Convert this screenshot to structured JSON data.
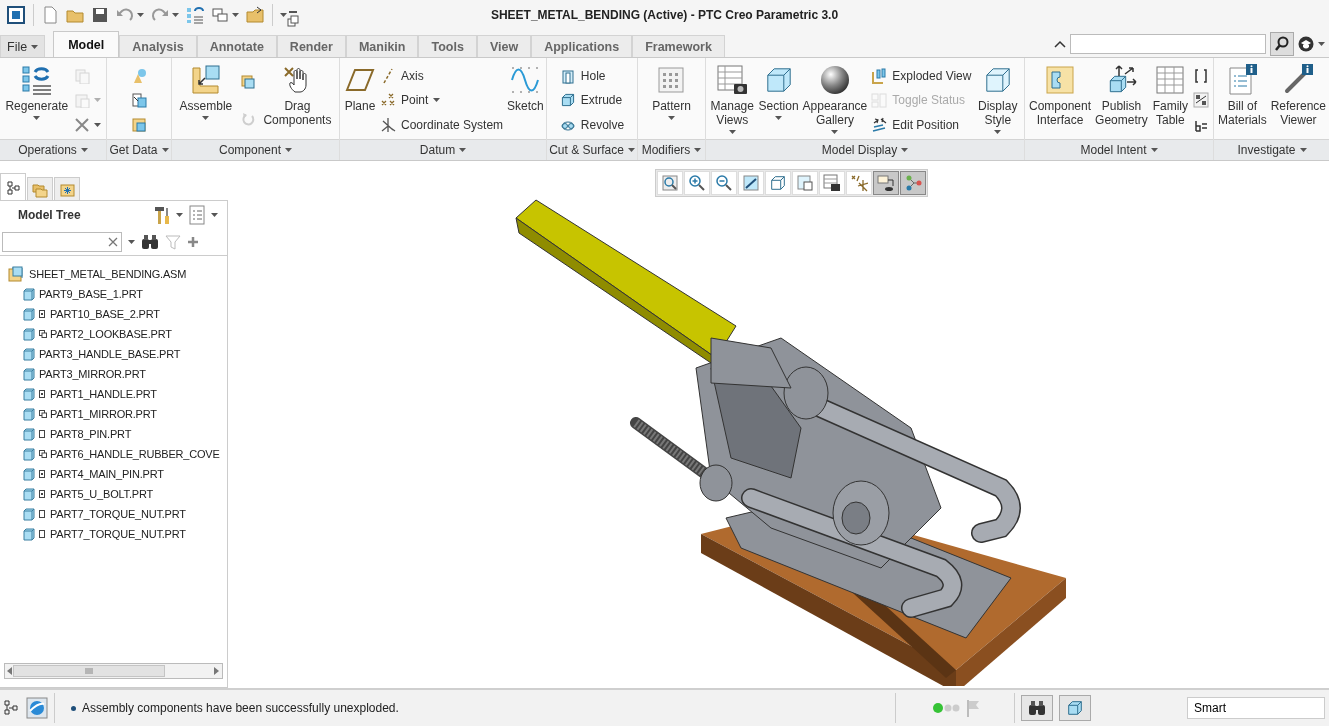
{
  "window": {
    "title": "SHEET_METAL_BENDING (Active) - PTC Creo Parametric 3.0"
  },
  "file_menu": {
    "label": "File"
  },
  "tabs": [
    {
      "label": "Model",
      "selected": true
    },
    {
      "label": "Analysis",
      "selected": false
    },
    {
      "label": "Annotate",
      "selected": false
    },
    {
      "label": "Render",
      "selected": false
    },
    {
      "label": "Manikin",
      "selected": false
    },
    {
      "label": "Tools",
      "selected": false
    },
    {
      "label": "View",
      "selected": false
    },
    {
      "label": "Applications",
      "selected": false
    },
    {
      "label": "Framework",
      "selected": false
    }
  ],
  "ribbon": {
    "groups": [
      {
        "label": "Operations",
        "items": [
          {
            "kind": "large",
            "label": "Regenerate",
            "dropdown": true,
            "disabled": false
          },
          {
            "kind": "icon",
            "dropdown": false,
            "disabled": true
          },
          {
            "kind": "icon",
            "dropdown": true,
            "disabled": true
          },
          {
            "kind": "icon",
            "dropdown": true,
            "disabled": false
          }
        ]
      },
      {
        "label": "Get Data",
        "items": [
          {
            "kind": "icon",
            "dropdown": false,
            "disabled": false
          },
          {
            "kind": "icon",
            "dropdown": false,
            "disabled": false
          },
          {
            "kind": "icon",
            "dropdown": false,
            "disabled": false
          }
        ]
      },
      {
        "label": "Component",
        "items": [
          {
            "kind": "large",
            "label": "Assemble",
            "dropdown": true,
            "disabled": false
          },
          {
            "kind": "icon",
            "dropdown": false,
            "disabled": false
          },
          {
            "kind": "icon",
            "dropdown": false,
            "disabled": true
          },
          {
            "kind": "large",
            "label": "Drag Components",
            "dropdown": false,
            "disabled": false
          }
        ]
      },
      {
        "label": "Datum",
        "items": [
          {
            "kind": "large",
            "label": "Plane",
            "dropdown": false,
            "disabled": false
          },
          {
            "kind": "small",
            "label": "Axis",
            "dropdown": false,
            "disabled": false
          },
          {
            "kind": "small",
            "label": "Point",
            "dropdown": true,
            "disabled": false
          },
          {
            "kind": "small",
            "label": "Coordinate System",
            "dropdown": false,
            "disabled": false
          },
          {
            "kind": "large",
            "label": "Sketch",
            "dropdown": false,
            "disabled": false
          }
        ]
      },
      {
        "label": "Cut & Surface",
        "items": [
          {
            "kind": "small",
            "label": "Hole",
            "dropdown": false,
            "disabled": false
          },
          {
            "kind": "small",
            "label": "Extrude",
            "dropdown": false,
            "disabled": false
          },
          {
            "kind": "small",
            "label": "Revolve",
            "dropdown": false,
            "disabled": false
          }
        ]
      },
      {
        "label": "Modifiers",
        "items": [
          {
            "kind": "large",
            "label": "Pattern",
            "dropdown": true,
            "disabled": false
          }
        ]
      },
      {
        "label": "Model Display",
        "items": [
          {
            "kind": "large",
            "label": "Manage Views",
            "dropdown": true,
            "disabled": false
          },
          {
            "kind": "large",
            "label": "Section",
            "dropdown": true,
            "disabled": false
          },
          {
            "kind": "large",
            "label": "Appearance Gallery",
            "dropdown": true,
            "disabled": false
          },
          {
            "kind": "small",
            "label": "Exploded View",
            "dropdown": false,
            "disabled": false
          },
          {
            "kind": "small",
            "label": "Toggle Status",
            "dropdown": false,
            "disabled": true
          },
          {
            "kind": "small",
            "label": "Edit Position",
            "dropdown": false,
            "disabled": false
          },
          {
            "kind": "large",
            "label": "Display Style",
            "dropdown": true,
            "disabled": false
          }
        ]
      },
      {
        "label": "Model Intent",
        "items": [
          {
            "kind": "large",
            "label": "Component Interface",
            "dropdown": false,
            "disabled": false
          },
          {
            "kind": "large",
            "label": "Publish Geometry",
            "dropdown": false,
            "disabled": false
          },
          {
            "kind": "large",
            "label": "Family Table",
            "dropdown": false,
            "disabled": false
          },
          {
            "kind": "icon",
            "dropdown": false,
            "disabled": false
          },
          {
            "kind": "icon",
            "dropdown": false,
            "disabled": false
          },
          {
            "kind": "icon",
            "dropdown": false,
            "disabled": false
          }
        ]
      },
      {
        "label": "Investigate",
        "items": [
          {
            "kind": "large",
            "label": "Bill of Materials",
            "dropdown": false,
            "disabled": false
          },
          {
            "kind": "large",
            "label": "Reference Viewer",
            "dropdown": false,
            "disabled": false
          }
        ]
      }
    ]
  },
  "panel_tabs": [
    {
      "selected": true
    },
    {
      "selected": false
    },
    {
      "selected": false
    }
  ],
  "model_tree": {
    "title": "Model Tree",
    "root": {
      "label": "SHEET_METAL_BENDING.ASM",
      "children": [
        {
          "label": "PART9_BASE_1.PRT",
          "kind": "plain"
        },
        {
          "label": "PART10_BASE_2.PRT",
          "kind": "dot"
        },
        {
          "label": "PART2_LOOKBASE.PRT",
          "kind": "link"
        },
        {
          "label": "PART3_HANDLE_BASE.PRT",
          "kind": "plain"
        },
        {
          "label": "PART3_MIRROR.PRT",
          "kind": "plain"
        },
        {
          "label": "PART1_HANDLE.PRT",
          "kind": "dot"
        },
        {
          "label": "PART1_MIRROR.PRT",
          "kind": "link"
        },
        {
          "label": "PART8_PIN.PRT",
          "kind": "box"
        },
        {
          "label": "PART6_HANDLE_RUBBER_COVE",
          "kind": "link"
        },
        {
          "label": "PART4_MAIN_PIN.PRT",
          "kind": "dot"
        },
        {
          "label": "PART5_U_BOLT.PRT",
          "kind": "dot"
        },
        {
          "label": "PART7_TORQUE_NUT.PRT",
          "kind": "box"
        },
        {
          "label": "PART7_TORQUE_NUT.PRT",
          "kind": "box"
        }
      ]
    }
  },
  "view_toolbar": [
    {
      "selected": false
    },
    {
      "selected": false
    },
    {
      "selected": false
    },
    {
      "selected": false
    },
    {
      "selected": false
    },
    {
      "selected": false
    },
    {
      "selected": false
    },
    {
      "selected": false
    },
    {
      "selected": true
    },
    {
      "selected": true
    }
  ],
  "status_bar": {
    "message": "Assembly components have been successfully unexploded.",
    "filter": {
      "value": "Smart"
    }
  }
}
